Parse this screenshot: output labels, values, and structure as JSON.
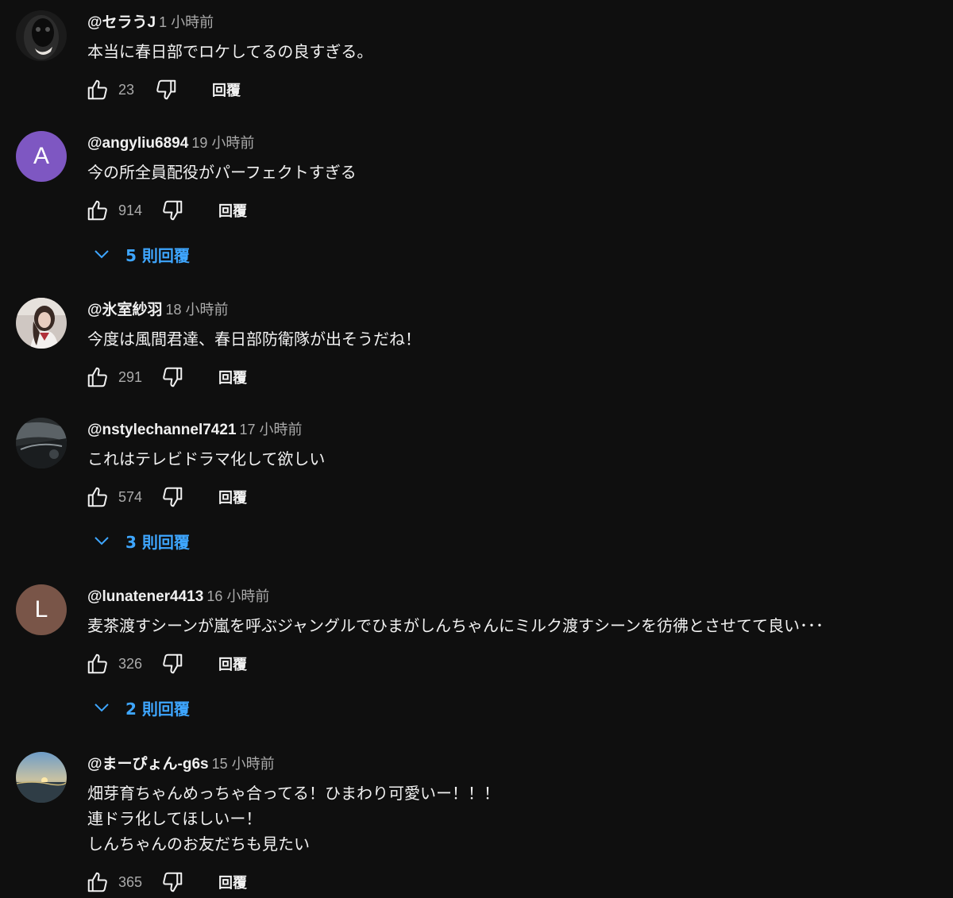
{
  "comments": [
    {
      "author": "@セラうJ",
      "time": "1 小時前",
      "text": [
        "本当に春日部でロケしてるの良すぎる。"
      ],
      "likes": "23",
      "reply_label": "回覆",
      "avatar": {
        "type": "image",
        "description": "dark-portrait"
      }
    },
    {
      "author": "@angyliu6894",
      "time": "19 小時前",
      "text": [
        "今の所全員配役がパーフェクトすぎる"
      ],
      "likes": "914",
      "reply_label": "回覆",
      "avatar": {
        "type": "letter",
        "letter": "A",
        "color": "#7e57c2"
      },
      "replies_label": "5 則回覆"
    },
    {
      "author": "@氷室紗羽",
      "time": "18 小時前",
      "text": [
        "今度は風間君達、春日部防衛隊が出そうだね！"
      ],
      "likes": "291",
      "reply_label": "回覆",
      "avatar": {
        "type": "image",
        "description": "person-portrait"
      }
    },
    {
      "author": "@nstylechannel7421",
      "time": "17 小時前",
      "text": [
        "これはテレビドラマ化して欲しい"
      ],
      "likes": "574",
      "reply_label": "回覆",
      "avatar": {
        "type": "image",
        "description": "car-interior"
      },
      "replies_label": "3 則回覆"
    },
    {
      "author": "@lunatener4413",
      "time": "16 小時前",
      "text": [
        "麦茶渡すシーンが嵐を呼ぶジャングルでひまがしんちゃんにミルク渡すシーンを彷彿とさせてて良い･･･"
      ],
      "likes": "326",
      "reply_label": "回覆",
      "avatar": {
        "type": "letter",
        "letter": "L",
        "color": "#795548"
      },
      "replies_label": "2 則回覆"
    },
    {
      "author": "@まーぴょん-g6s",
      "time": "15 小時前",
      "text": [
        "畑芽育ちゃんめっちゃ合ってる！ひまわり可愛いー！！！",
        "連ドラ化してほしいー！",
        "しんちゃんのお友だちも見たい"
      ],
      "likes": "365",
      "reply_label": "回覆",
      "avatar": {
        "type": "image",
        "description": "sunset-landscape"
      }
    }
  ],
  "colors": {
    "background": "#0f0f0f",
    "text": "#f1f1f1",
    "secondary": "#aaaaaa",
    "link": "#3ea6ff"
  },
  "icons": {
    "like": "thumbs-up-icon",
    "dislike": "thumbs-down-icon",
    "expand": "chevron-down-icon"
  }
}
